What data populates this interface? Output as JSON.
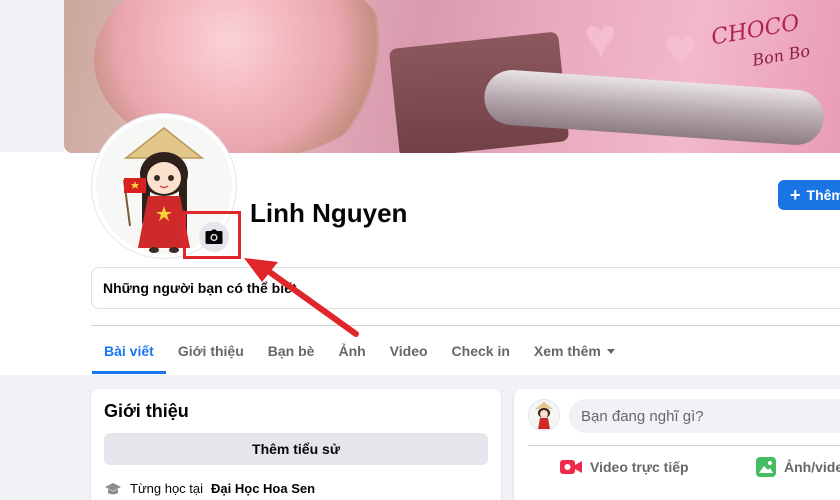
{
  "profile": {
    "name": "Linh Nguyen",
    "cover_brand": "CHOCO",
    "cover_brand_sub": "Bon Bo"
  },
  "header": {
    "add_button_label": "Thêm"
  },
  "suggestions": {
    "label": "Những người bạn có thể biết"
  },
  "tabs": [
    {
      "label": "Bài viết",
      "active": true
    },
    {
      "label": "Giới thiệu"
    },
    {
      "label": "Bạn bè"
    },
    {
      "label": "Ảnh"
    },
    {
      "label": "Video"
    },
    {
      "label": "Check in"
    },
    {
      "label": "Xem thêm"
    }
  ],
  "intro": {
    "title": "Giới thiệu",
    "bio_button": "Thêm tiểu sử",
    "study_prefix": "Từng học tại",
    "study_school": "Đại Học Hoa Sen"
  },
  "composer": {
    "placeholder": "Bạn đang nghĩ gì?",
    "live_video": "Video trực tiếp",
    "photo_video": "Ảnh/video"
  },
  "icons": {
    "camera": "camera-icon",
    "plus": "plus-icon",
    "school": "graduation-cap-icon",
    "live": "live-video-icon",
    "photo": "photo-icon"
  },
  "colors": {
    "accent": "#1877f2",
    "highlight": "#e0262b"
  }
}
